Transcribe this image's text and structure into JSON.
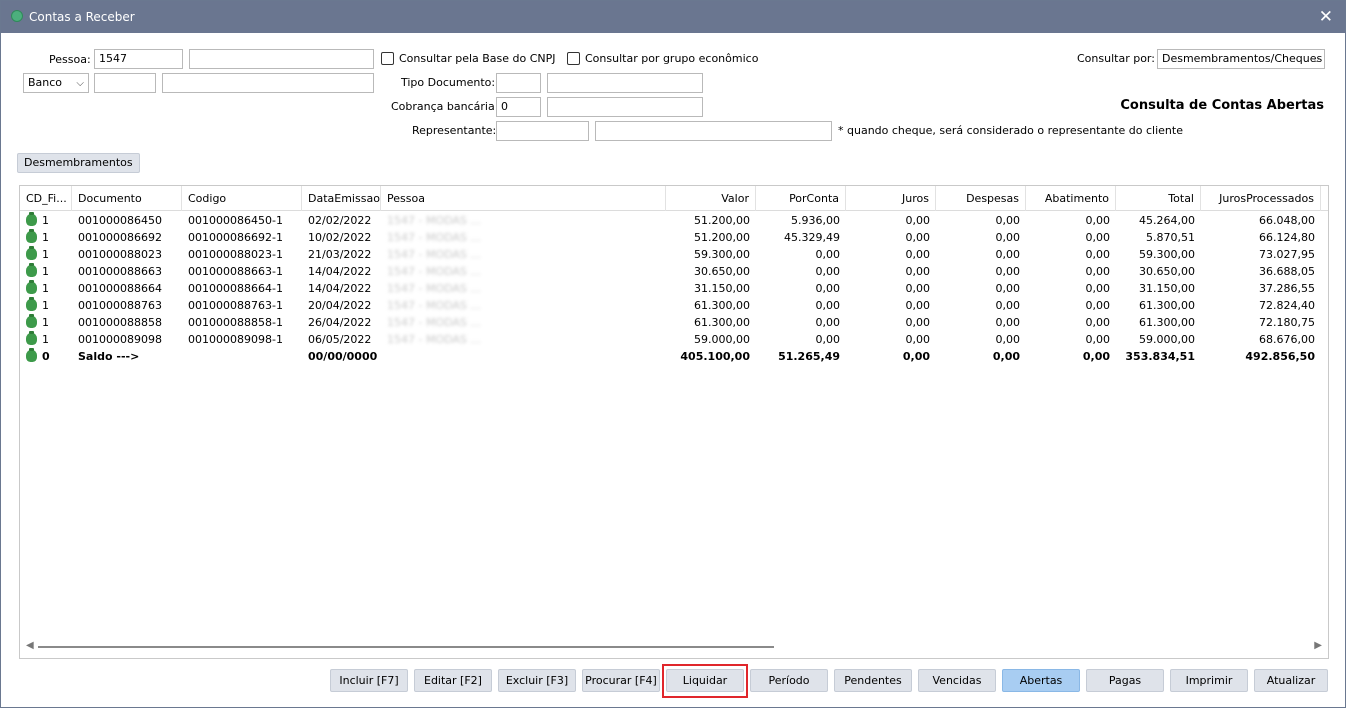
{
  "window": {
    "title": "Contas a Receber"
  },
  "filters": {
    "pessoa_label": "Pessoa:",
    "pessoa_code": "1547",
    "pessoa_name": "",
    "cnpj_check_label": "Consultar pela Base do CNPJ",
    "grupo_check_label": "Consultar por grupo econômico",
    "consultar_por_label": "Consultar por:",
    "consultar_por_value": "Desmembramentos/Cheques",
    "banco_select": "Banco",
    "banco_code": "",
    "banco_name": "",
    "tipo_documento_label": "Tipo Documento:",
    "tipo_documento_code": "",
    "tipo_documento_name": "",
    "cobranca_label": "Cobrança bancária:",
    "cobranca_code": "0",
    "cobranca_name": "",
    "representante_label": "Representante:",
    "representante_code": "",
    "representante_name": "",
    "cheque_note": "* quando cheque, será considerado o representante do cliente",
    "heading": "Consulta de Contas Abertas"
  },
  "tab": {
    "label": "Desmembramentos"
  },
  "grid": {
    "columns": [
      "CD_Fi...",
      "Documento",
      "Codigo",
      "DataEmissao",
      "Pessoa",
      "Valor",
      "PorConta",
      "Juros",
      "Despesas",
      "Abatimento",
      "Total",
      "JurosProcessados"
    ],
    "rows": [
      {
        "cd": "1",
        "documento": "001000086450",
        "codigo": "001000086450-1",
        "data": "02/02/2022",
        "pessoa": "1547 - MODAS ...",
        "valor": "51.200,00",
        "porconta": "5.936,00",
        "juros": "0,00",
        "despesas": "0,00",
        "abatimento": "0,00",
        "total": "45.264,00",
        "jurosproc": "66.048,00"
      },
      {
        "cd": "1",
        "documento": "001000086692",
        "codigo": "001000086692-1",
        "data": "10/02/2022",
        "pessoa": "1547 - MODAS ...",
        "valor": "51.200,00",
        "porconta": "45.329,49",
        "juros": "0,00",
        "despesas": "0,00",
        "abatimento": "0,00",
        "total": "5.870,51",
        "jurosproc": "66.124,80"
      },
      {
        "cd": "1",
        "documento": "001000088023",
        "codigo": "001000088023-1",
        "data": "21/03/2022",
        "pessoa": "1547 - MODAS ...",
        "valor": "59.300,00",
        "porconta": "0,00",
        "juros": "0,00",
        "despesas": "0,00",
        "abatimento": "0,00",
        "total": "59.300,00",
        "jurosproc": "73.027,95"
      },
      {
        "cd": "1",
        "documento": "001000088663",
        "codigo": "001000088663-1",
        "data": "14/04/2022",
        "pessoa": "1547 - MODAS ...",
        "valor": "30.650,00",
        "porconta": "0,00",
        "juros": "0,00",
        "despesas": "0,00",
        "abatimento": "0,00",
        "total": "30.650,00",
        "jurosproc": "36.688,05"
      },
      {
        "cd": "1",
        "documento": "001000088664",
        "codigo": "001000088664-1",
        "data": "14/04/2022",
        "pessoa": "1547 - MODAS ...",
        "valor": "31.150,00",
        "porconta": "0,00",
        "juros": "0,00",
        "despesas": "0,00",
        "abatimento": "0,00",
        "total": "31.150,00",
        "jurosproc": "37.286,55"
      },
      {
        "cd": "1",
        "documento": "001000088763",
        "codigo": "001000088763-1",
        "data": "20/04/2022",
        "pessoa": "1547 - MODAS ...",
        "valor": "61.300,00",
        "porconta": "0,00",
        "juros": "0,00",
        "despesas": "0,00",
        "abatimento": "0,00",
        "total": "61.300,00",
        "jurosproc": "72.824,40"
      },
      {
        "cd": "1",
        "documento": "001000088858",
        "codigo": "001000088858-1",
        "data": "26/04/2022",
        "pessoa": "1547 - MODAS ...",
        "valor": "61.300,00",
        "porconta": "0,00",
        "juros": "0,00",
        "despesas": "0,00",
        "abatimento": "0,00",
        "total": "61.300,00",
        "jurosproc": "72.180,75"
      },
      {
        "cd": "1",
        "documento": "001000089098",
        "codigo": "001000089098-1",
        "data": "06/05/2022",
        "pessoa": "1547 - MODAS ...",
        "valor": "59.000,00",
        "porconta": "0,00",
        "juros": "0,00",
        "despesas": "0,00",
        "abatimento": "0,00",
        "total": "59.000,00",
        "jurosproc": "68.676,00"
      }
    ],
    "total_row": {
      "cd": "0",
      "documento": "Saldo --->",
      "codigo": "",
      "data": "00/00/0000",
      "pessoa": "",
      "valor": "405.100,00",
      "porconta": "51.265,49",
      "juros": "0,00",
      "despesas": "0,00",
      "abatimento": "0,00",
      "total": "353.834,51",
      "jurosproc": "492.856,50"
    }
  },
  "buttons": {
    "incluir": "Incluir [F7]",
    "editar": "Editar [F2]",
    "excluir": "Excluir [F3]",
    "procurar": "Procurar [F4]",
    "liquidar": "Liquidar",
    "periodo": "Período",
    "pendentes": "Pendentes",
    "vencidas": "Vencidas",
    "abertas": "Abertas",
    "pagas": "Pagas",
    "imprimir": "Imprimir",
    "atualizar": "Atualizar"
  },
  "icons": {
    "close": "close-icon",
    "row": "money-bag-icon",
    "dropdown": "chevron-down-icon"
  },
  "colors": {
    "titlebar": "#6a7690",
    "active_button": "#a8cdf2",
    "highlight": "#e0262b",
    "icon_green": "#3d9a4a"
  }
}
